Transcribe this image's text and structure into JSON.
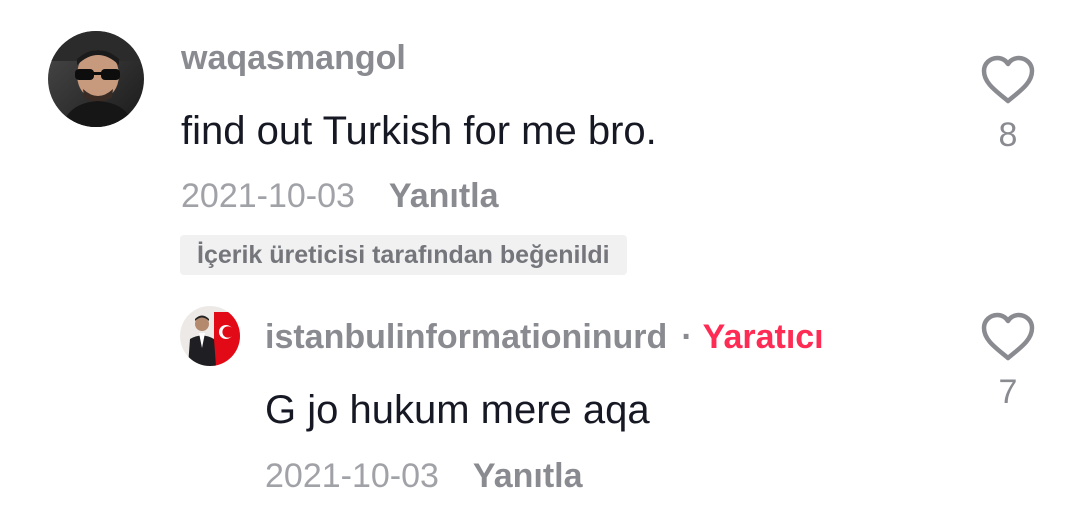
{
  "comments": [
    {
      "username": "waqasmangol",
      "text": "find out Turkish for me bro.",
      "date": "2021-10-03",
      "reply_label": "Yanıtla",
      "liked_by_creator": "İçerik üreticisi tarafından beğenildi",
      "like_icon": "heart-outline-icon",
      "like_count": "8",
      "replies": [
        {
          "username": "istanbulinformationinurd",
          "separator": "·",
          "creator_badge": "Yaratıcı",
          "creator_color": "#fe2c55",
          "text": "G jo hukum mere aqa",
          "date": "2021-10-03",
          "reply_label": "Yanıtla",
          "like_icon": "heart-outline-icon",
          "like_count": "7"
        }
      ]
    }
  ]
}
